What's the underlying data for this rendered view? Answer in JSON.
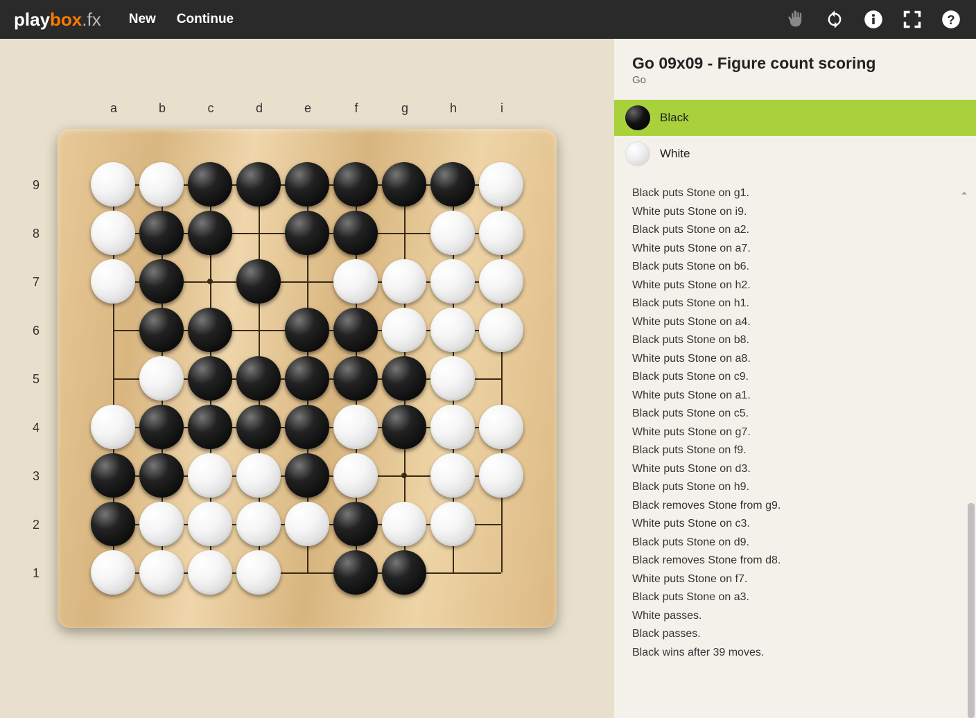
{
  "header": {
    "logo_p1": "play",
    "logo_p2": "box",
    "logo_p3": ".fx",
    "nav": {
      "new": "New",
      "continue": "Continue"
    }
  },
  "side": {
    "title": "Go 09x09 - Figure count scoring",
    "subtitle": "Go",
    "players": [
      {
        "label": "Black",
        "color": "B",
        "active": true
      },
      {
        "label": "White",
        "color": "W",
        "active": false
      }
    ]
  },
  "board": {
    "size": 9,
    "cols": [
      "a",
      "b",
      "c",
      "d",
      "e",
      "f",
      "g",
      "h",
      "i"
    ],
    "rows": [
      "9",
      "8",
      "7",
      "6",
      "5",
      "4",
      "3",
      "2",
      "1"
    ],
    "star_points": [
      [
        3,
        3
      ],
      [
        7,
        3
      ],
      [
        5,
        5
      ],
      [
        3,
        7
      ],
      [
        7,
        7
      ]
    ],
    "stones": [
      {
        "c": 1,
        "r": 1,
        "k": "W"
      },
      {
        "c": 2,
        "r": 1,
        "k": "W"
      },
      {
        "c": 3,
        "r": 1,
        "k": "B"
      },
      {
        "c": 4,
        "r": 1,
        "k": "B"
      },
      {
        "c": 5,
        "r": 1,
        "k": "B"
      },
      {
        "c": 6,
        "r": 1,
        "k": "B"
      },
      {
        "c": 7,
        "r": 1,
        "k": "B"
      },
      {
        "c": 8,
        "r": 1,
        "k": "B"
      },
      {
        "c": 9,
        "r": 1,
        "k": "W"
      },
      {
        "c": 1,
        "r": 2,
        "k": "W"
      },
      {
        "c": 2,
        "r": 2,
        "k": "B"
      },
      {
        "c": 3,
        "r": 2,
        "k": "B"
      },
      {
        "c": 5,
        "r": 2,
        "k": "B"
      },
      {
        "c": 6,
        "r": 2,
        "k": "B"
      },
      {
        "c": 8,
        "r": 2,
        "k": "W"
      },
      {
        "c": 9,
        "r": 2,
        "k": "W"
      },
      {
        "c": 1,
        "r": 3,
        "k": "W"
      },
      {
        "c": 2,
        "r": 3,
        "k": "B"
      },
      {
        "c": 4,
        "r": 3,
        "k": "B"
      },
      {
        "c": 6,
        "r": 3,
        "k": "W"
      },
      {
        "c": 7,
        "r": 3,
        "k": "W"
      },
      {
        "c": 8,
        "r": 3,
        "k": "W"
      },
      {
        "c": 9,
        "r": 3,
        "k": "W"
      },
      {
        "c": 2,
        "r": 4,
        "k": "B"
      },
      {
        "c": 3,
        "r": 4,
        "k": "B"
      },
      {
        "c": 5,
        "r": 4,
        "k": "B"
      },
      {
        "c": 6,
        "r": 4,
        "k": "B"
      },
      {
        "c": 7,
        "r": 4,
        "k": "W"
      },
      {
        "c": 8,
        "r": 4,
        "k": "W"
      },
      {
        "c": 9,
        "r": 4,
        "k": "W"
      },
      {
        "c": 2,
        "r": 5,
        "k": "W"
      },
      {
        "c": 3,
        "r": 5,
        "k": "B"
      },
      {
        "c": 4,
        "r": 5,
        "k": "B"
      },
      {
        "c": 5,
        "r": 5,
        "k": "B"
      },
      {
        "c": 6,
        "r": 5,
        "k": "B"
      },
      {
        "c": 7,
        "r": 5,
        "k": "B"
      },
      {
        "c": 8,
        "r": 5,
        "k": "W"
      },
      {
        "c": 1,
        "r": 6,
        "k": "W"
      },
      {
        "c": 2,
        "r": 6,
        "k": "B"
      },
      {
        "c": 3,
        "r": 6,
        "k": "B"
      },
      {
        "c": 4,
        "r": 6,
        "k": "B"
      },
      {
        "c": 5,
        "r": 6,
        "k": "B"
      },
      {
        "c": 6,
        "r": 6,
        "k": "W"
      },
      {
        "c": 7,
        "r": 6,
        "k": "B"
      },
      {
        "c": 8,
        "r": 6,
        "k": "W"
      },
      {
        "c": 9,
        "r": 6,
        "k": "W"
      },
      {
        "c": 1,
        "r": 7,
        "k": "B"
      },
      {
        "c": 2,
        "r": 7,
        "k": "B"
      },
      {
        "c": 3,
        "r": 7,
        "k": "W"
      },
      {
        "c": 4,
        "r": 7,
        "k": "W"
      },
      {
        "c": 5,
        "r": 7,
        "k": "B"
      },
      {
        "c": 6,
        "r": 7,
        "k": "W"
      },
      {
        "c": 8,
        "r": 7,
        "k": "W"
      },
      {
        "c": 9,
        "r": 7,
        "k": "W"
      },
      {
        "c": 1,
        "r": 8,
        "k": "B"
      },
      {
        "c": 2,
        "r": 8,
        "k": "W"
      },
      {
        "c": 3,
        "r": 8,
        "k": "W"
      },
      {
        "c": 4,
        "r": 8,
        "k": "W"
      },
      {
        "c": 5,
        "r": 8,
        "k": "W"
      },
      {
        "c": 6,
        "r": 8,
        "k": "B"
      },
      {
        "c": 7,
        "r": 8,
        "k": "W"
      },
      {
        "c": 8,
        "r": 8,
        "k": "W"
      },
      {
        "c": 1,
        "r": 9,
        "k": "W"
      },
      {
        "c": 2,
        "r": 9,
        "k": "W"
      },
      {
        "c": 3,
        "r": 9,
        "k": "W"
      },
      {
        "c": 4,
        "r": 9,
        "k": "W"
      },
      {
        "c": 6,
        "r": 9,
        "k": "B"
      },
      {
        "c": 7,
        "r": 9,
        "k": "B"
      }
    ]
  },
  "log": [
    "Black puts Stone on g1.",
    "White puts Stone on i9.",
    "Black puts Stone on a2.",
    "White puts Stone on a7.",
    "Black puts Stone on b6.",
    "White puts Stone on h2.",
    "Black puts Stone on h1.",
    "White puts Stone on a4.",
    "Black puts Stone on b8.",
    "White puts Stone on a8.",
    "Black puts Stone on c9.",
    "White puts Stone on a1.",
    "Black puts Stone on c5.",
    "White puts Stone on g7.",
    "Black puts Stone on f9.",
    "White puts Stone on d3.",
    "Black puts Stone on h9.",
    "Black removes Stone from g9.",
    "White puts Stone on c3.",
    "Black puts Stone on d9.",
    "Black removes Stone from d8.",
    "White puts Stone on f7.",
    "Black puts Stone on a3.",
    "White passes.",
    "Black passes.",
    "Black wins after 39 moves."
  ]
}
